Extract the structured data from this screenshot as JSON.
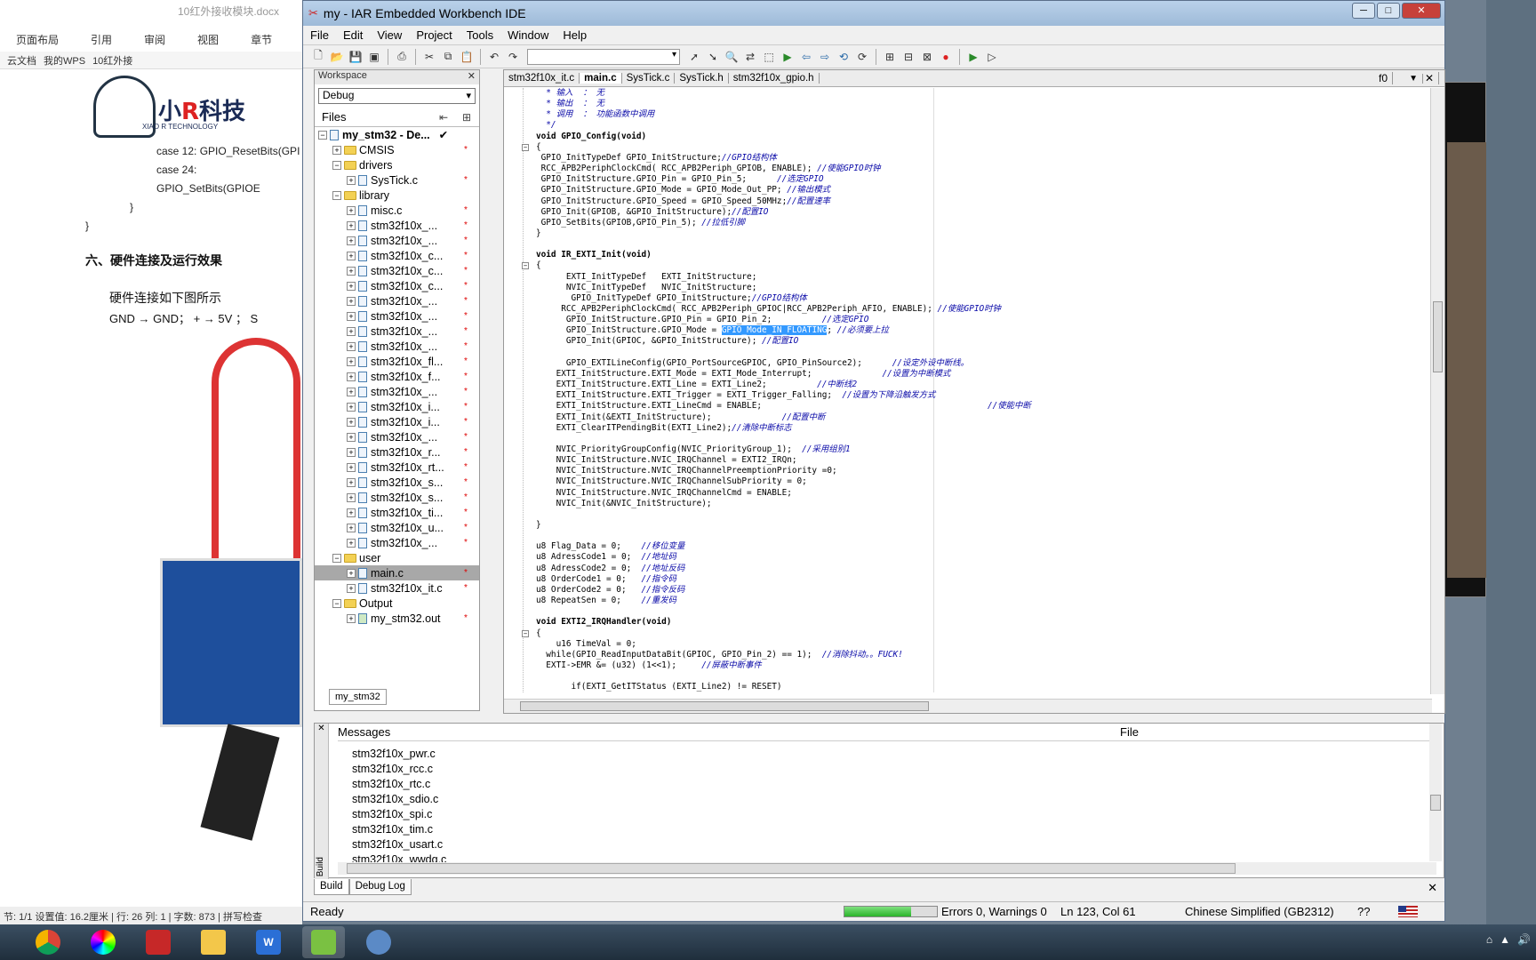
{
  "wps": {
    "title": "10红外接收模块.docx",
    "menu": [
      "页面布局",
      "引用",
      "审阅",
      "视图",
      "章节"
    ],
    "tabs": [
      "云文档",
      "我的WPS",
      "10红外接"
    ],
    "logo_text": "小R科技",
    "logo_sub": "XIAO R TECHNOLOGY",
    "code_lines": [
      "case 12: GPIO_ResetBits(GPI",
      "case 24: GPIO_SetBits(GPIOE",
      "}",
      "}"
    ],
    "heading": "六、硬件连接及运行效果",
    "para1": "硬件连接如下图所示",
    "para2": "GND → GND； + → 5V ；  S",
    "status": "节: 1/1  设置值: 16.2厘米 | 行: 26  列: 1 | 字数: 873 | 拼写检查"
  },
  "ide": {
    "title": "my - IAR Embedded Workbench IDE",
    "menu": [
      "File",
      "Edit",
      "View",
      "Project",
      "Tools",
      "Window",
      "Help"
    ],
    "workspace": {
      "header": "Workspace",
      "config": "Debug",
      "files_label": "Files",
      "tab": "my_stm32",
      "tree": [
        {
          "label": "my_stm32 - De...",
          "level": 0,
          "type": "project",
          "check": "✔"
        },
        {
          "label": "CMSIS",
          "level": 1,
          "type": "folder",
          "exp": "+",
          "star": true
        },
        {
          "label": "drivers",
          "level": 1,
          "type": "folder",
          "exp": "-"
        },
        {
          "label": "SysTick.c",
          "level": 2,
          "type": "file",
          "exp": "+",
          "star": true
        },
        {
          "label": "library",
          "level": 1,
          "type": "folder",
          "exp": "-"
        },
        {
          "label": "misc.c",
          "level": 2,
          "type": "file",
          "exp": "+",
          "star": true
        },
        {
          "label": "stm32f10x_...",
          "level": 2,
          "type": "file",
          "exp": "+",
          "star": true
        },
        {
          "label": "stm32f10x_...",
          "level": 2,
          "type": "file",
          "exp": "+",
          "star": true
        },
        {
          "label": "stm32f10x_c...",
          "level": 2,
          "type": "file",
          "exp": "+",
          "star": true
        },
        {
          "label": "stm32f10x_c...",
          "level": 2,
          "type": "file",
          "exp": "+",
          "star": true
        },
        {
          "label": "stm32f10x_c...",
          "level": 2,
          "type": "file",
          "exp": "+",
          "star": true
        },
        {
          "label": "stm32f10x_...",
          "level": 2,
          "type": "file",
          "exp": "+",
          "star": true
        },
        {
          "label": "stm32f10x_...",
          "level": 2,
          "type": "file",
          "exp": "+",
          "star": true
        },
        {
          "label": "stm32f10x_...",
          "level": 2,
          "type": "file",
          "exp": "+",
          "star": true
        },
        {
          "label": "stm32f10x_...",
          "level": 2,
          "type": "file",
          "exp": "+",
          "star": true
        },
        {
          "label": "stm32f10x_fl...",
          "level": 2,
          "type": "file",
          "exp": "+",
          "star": true
        },
        {
          "label": "stm32f10x_f...",
          "level": 2,
          "type": "file",
          "exp": "+",
          "star": true
        },
        {
          "label": "stm32f10x_...",
          "level": 2,
          "type": "file",
          "exp": "+",
          "star": true
        },
        {
          "label": "stm32f10x_i...",
          "level": 2,
          "type": "file",
          "exp": "+",
          "star": true
        },
        {
          "label": "stm32f10x_i...",
          "level": 2,
          "type": "file",
          "exp": "+",
          "star": true
        },
        {
          "label": "stm32f10x_...",
          "level": 2,
          "type": "file",
          "exp": "+",
          "star": true
        },
        {
          "label": "stm32f10x_r...",
          "level": 2,
          "type": "file",
          "exp": "+",
          "star": true
        },
        {
          "label": "stm32f10x_rt...",
          "level": 2,
          "type": "file",
          "exp": "+",
          "star": true
        },
        {
          "label": "stm32f10x_s...",
          "level": 2,
          "type": "file",
          "exp": "+",
          "star": true
        },
        {
          "label": "stm32f10x_s...",
          "level": 2,
          "type": "file",
          "exp": "+",
          "star": true
        },
        {
          "label": "stm32f10x_ti...",
          "level": 2,
          "type": "file",
          "exp": "+",
          "star": true
        },
        {
          "label": "stm32f10x_u...",
          "level": 2,
          "type": "file",
          "exp": "+",
          "star": true
        },
        {
          "label": "stm32f10x_...",
          "level": 2,
          "type": "file",
          "exp": "+",
          "star": true
        },
        {
          "label": "user",
          "level": 1,
          "type": "folder",
          "exp": "-"
        },
        {
          "label": "main.c",
          "level": 2,
          "type": "file",
          "exp": "+",
          "star": true,
          "selected": true
        },
        {
          "label": "stm32f10x_it.c",
          "level": 2,
          "type": "file",
          "exp": "+",
          "star": true
        },
        {
          "label": "Output",
          "level": 1,
          "type": "folder",
          "exp": "-"
        },
        {
          "label": "my_stm32.out",
          "level": 2,
          "type": "output",
          "exp": "+",
          "star": true
        }
      ]
    },
    "editor": {
      "tabs": [
        "stm32f10x_it.c",
        "main.c",
        "SysTick.c",
        "SysTick.h",
        "stm32f10x_gpio.h"
      ],
      "active_tab": "main.c",
      "function": "f0",
      "lines": [
        {
          "t": "  * 输入  ： 无",
          "c": true
        },
        {
          "t": "  * 输出  ： 无",
          "c": true
        },
        {
          "t": "  * 调用  ： 功能函数中调用",
          "c": true
        },
        {
          "t": "  */",
          "c": true
        },
        {
          "t": "void GPIO_Config(void)",
          "k": true
        },
        {
          "t": "{"
        },
        {
          "t": " GPIO_InitTypeDef GPIO_InitStructure;",
          "cm": "//GPIO结构体"
        },
        {
          "t": " RCC_APB2PeriphClockCmd( RCC_APB2Periph_GPIOB, ENABLE); ",
          "cm": "//使能GPIO时钟"
        },
        {
          "t": " GPIO_InitStructure.GPIO_Pin = GPIO_Pin_5;      ",
          "cm": "//选定GPIO"
        },
        {
          "t": " GPIO_InitStructure.GPIO_Mode = GPIO_Mode_Out_PP; ",
          "cm": "//输出模式"
        },
        {
          "t": " GPIO_InitStructure.GPIO_Speed = GPIO_Speed_50MHz;",
          "cm": "//配置速率"
        },
        {
          "t": " GPIO_Init(GPIOB, &GPIO_InitStructure);",
          "cm": "//配置IO"
        },
        {
          "t": " GPIO_SetBits(GPIOB,GPIO_Pin_5); ",
          "cm": "//拉低引脚"
        },
        {
          "t": "}"
        },
        {
          "t": ""
        },
        {
          "t": "void IR_EXTI_Init(void)",
          "k": true
        },
        {
          "t": "{"
        },
        {
          "t": "      EXTI_InitTypeDef   EXTI_InitStructure;"
        },
        {
          "t": "      NVIC_InitTypeDef   NVIC_InitStructure;"
        },
        {
          "t": "       GPIO_InitTypeDef GPIO_InitStructure;",
          "cm": "//GPIO结构体"
        },
        {
          "t": "     RCC_APB2PeriphClockCmd( RCC_APB2Periph_GPIOC|RCC_APB2Periph_AFIO, ENABLE); ",
          "cm": "//使能GPIO时钟"
        },
        {
          "t": "      GPIO_InitStructure.GPIO_Pin = GPIO_Pin_2;          ",
          "cm": "//选定GPIO"
        },
        {
          "t": "      GPIO_InitStructure.GPIO_Mode = ",
          "hl": "GPIO_Mode_IN_FLOATING",
          "after": "; ",
          "cm": "//必须要上拉"
        },
        {
          "t": "      GPIO_Init(GPIOC, &GPIO_InitStructure); ",
          "cm": "//配置IO"
        },
        {
          "t": ""
        },
        {
          "t": "      GPIO_EXTILineConfig(GPIO_PortSourceGPIOC, GPIO_PinSource2);      ",
          "cm": "//设定外设中断线。"
        },
        {
          "t": "    EXTI_InitStructure.EXTI_Mode = EXTI_Mode_Interrupt;              ",
          "cm": "//设置为中断模式"
        },
        {
          "t": "    EXTI_InitStructure.EXTI_Line = EXTI_Line2;          ",
          "cm": "//中断线2"
        },
        {
          "t": "    EXTI_InitStructure.EXTI_Trigger = EXTI_Trigger_Falling;  ",
          "cm": "//设置为下降沿触发方式"
        },
        {
          "t": "    EXTI_InitStructure.EXTI_LineCmd = ENABLE;                                             ",
          "cm": "//使能中断"
        },
        {
          "t": "    EXTI_Init(&EXTI_InitStructure);              ",
          "cm": "//配置中断"
        },
        {
          "t": "    EXTI_ClearITPendingBit(EXTI_Line2);",
          "cm": "//清除中断标志"
        },
        {
          "t": ""
        },
        {
          "t": "    NVIC_PriorityGroupConfig(NVIC_PriorityGroup_1);  ",
          "cm": "//采用组别1"
        },
        {
          "t": "    NVIC_InitStructure.NVIC_IRQChannel = EXTI2_IRQn;"
        },
        {
          "t": "    NVIC_InitStructure.NVIC_IRQChannelPreemptionPriority =0;"
        },
        {
          "t": "    NVIC_InitStructure.NVIC_IRQChannelSubPriority = 0;"
        },
        {
          "t": "    NVIC_InitStructure.NVIC_IRQChannelCmd = ENABLE;"
        },
        {
          "t": "    NVIC_Init(&NVIC_InitStructure);"
        },
        {
          "t": ""
        },
        {
          "t": "}"
        },
        {
          "t": ""
        },
        {
          "t": "u8 Flag_Data = 0;    ",
          "cm": "//移位变量"
        },
        {
          "t": "u8 AdressCode1 = 0;  ",
          "cm": "//地址码"
        },
        {
          "t": "u8 AdressCode2 = 0;  ",
          "cm": "//地址反码"
        },
        {
          "t": "u8 OrderCode1 = 0;   ",
          "cm": "//指令码"
        },
        {
          "t": "u8 OrderCode2 = 0;   ",
          "cm": "//指令反码"
        },
        {
          "t": "u8 RepeatSen = 0;    ",
          "cm": "//重发码"
        },
        {
          "t": ""
        },
        {
          "t": "void EXTI2_IRQHandler(void)",
          "k": true
        },
        {
          "t": "{"
        },
        {
          "t": "    u16 TimeVal = 0;"
        },
        {
          "t": "  while(GPIO_ReadInputDataBit(GPIOC, GPIO_Pin_2) == 1);  ",
          "cm": "//消除抖动。。FUCK!"
        },
        {
          "t": "  EXTI->EMR &= (u32) (1<<1);     ",
          "cm": "//屏蔽中断事件"
        },
        {
          "t": ""
        },
        {
          "t": "       if(EXTI_GetITStatus (EXTI_Line2) != RESET)"
        },
        {
          "t": "       {"
        }
      ]
    },
    "messages": {
      "header": "Messages",
      "file_col": "File",
      "side_label": "Build",
      "items": [
        "stm32f10x_pwr.c",
        "stm32f10x_rcc.c",
        "stm32f10x_rtc.c",
        "stm32f10x_sdio.c",
        "stm32f10x_spi.c",
        "stm32f10x_tim.c",
        "stm32f10x_usart.c",
        "stm32f10x_wwdg.c"
      ],
      "tabs": [
        "Build",
        "Debug Log"
      ]
    },
    "status": {
      "ready": "Ready",
      "progress_fraction": 0.72,
      "errors": "Errors 0, Warnings 0",
      "position": "Ln 123, Col 61",
      "encoding": "Chinese Simplified (GB2312)",
      "help": "??"
    }
  },
  "taskbar": {
    "apps": [
      "chrome",
      "color-picker",
      "wps-pdf",
      "explorer",
      "wps-writer",
      "iar-ide",
      "webcam"
    ]
  }
}
